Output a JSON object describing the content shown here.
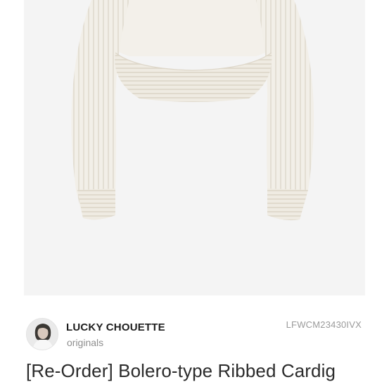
{
  "product": {
    "image_alt": "Ivory ribbed bolero cardigan, back view",
    "brand_name": "LUCKY CHOUETTE",
    "brand_subtitle": "originals",
    "product_code": "LFWCM23430IVX",
    "title": "[Re-Order] Bolero-type Ribbed Cardig"
  },
  "colors": {
    "image_background": "#f4f4f4",
    "garment": "#f1eee6"
  }
}
